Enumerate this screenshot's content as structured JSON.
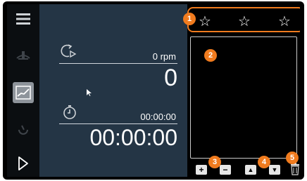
{
  "speed": {
    "label": "0 rpm",
    "value": "0"
  },
  "timer": {
    "label": "00:00:00",
    "value": "00:00:00"
  },
  "favorites": {
    "stars": [
      "☆",
      "☆",
      "☆"
    ]
  },
  "controls": {
    "add": "+",
    "remove": "−",
    "up": "▲",
    "down": "▼"
  },
  "callouts": [
    "1",
    "2",
    "3",
    "4",
    "5"
  ],
  "colors": {
    "accent": "#f07b1e",
    "panel": "#243545",
    "sidebar": "#0b0e11"
  },
  "icons": {
    "sidebar": [
      "menu-icon",
      "stirrer-icon",
      "chart-icon",
      "temperature-icon",
      "play-icon"
    ],
    "speed": "rotation-speed-icon",
    "timer": "stopwatch-icon"
  }
}
